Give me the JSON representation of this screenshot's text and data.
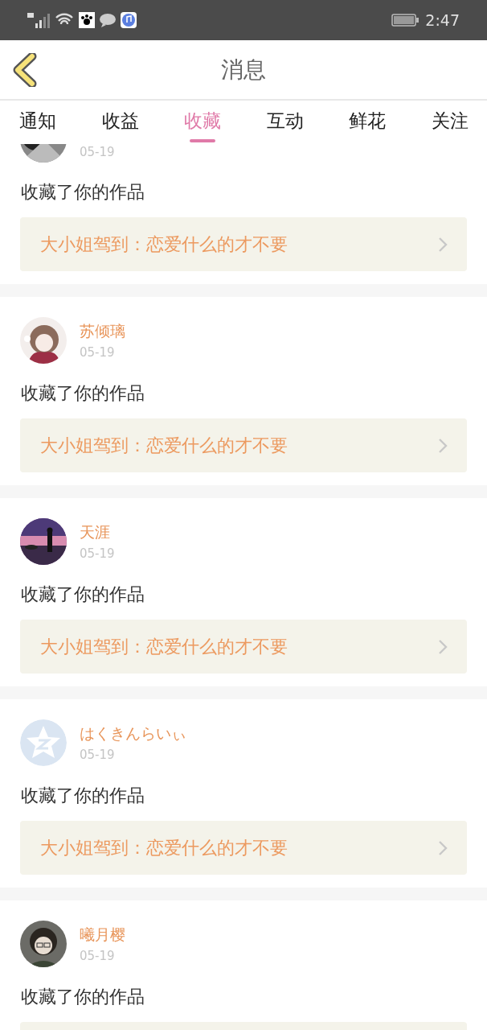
{
  "status_bar": {
    "time": "2:47"
  },
  "header": {
    "title": "消息"
  },
  "tabs": [
    {
      "label": "通知",
      "selected": false
    },
    {
      "label": "收益",
      "selected": false
    },
    {
      "label": "收藏",
      "selected": true
    },
    {
      "label": "互动",
      "selected": false
    },
    {
      "label": "鲜花",
      "selected": false
    },
    {
      "label": "关注",
      "selected": false
    }
  ],
  "items": [
    {
      "date": "05-19",
      "action": "收藏了你的作品",
      "work": "大小姐驾到：恋爱什么的才不要"
    },
    {
      "name": "苏倾璃",
      "date": "05-19",
      "action": "收藏了你的作品",
      "work": "大小姐驾到：恋爱什么的才不要"
    },
    {
      "name": "天涯",
      "date": "05-19",
      "action": "收藏了你的作品",
      "work": "大小姐驾到：恋爱什么的才不要"
    },
    {
      "avatar": {
        "kind": "default"
      },
      "name": "はくきんらいぃ",
      "date": "05-19",
      "action": "收藏了你的作品",
      "work": "大小姐驾到：恋爱什么的才不要"
    },
    {
      "name": "曦月樱",
      "date": "05-19",
      "action": "收藏了你的作品"
    }
  ]
}
